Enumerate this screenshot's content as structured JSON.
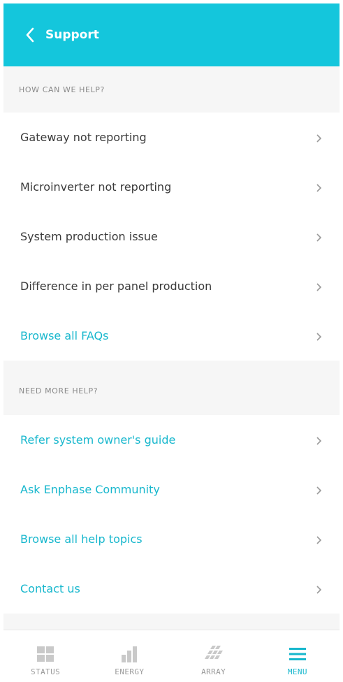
{
  "header": {
    "title": "Support",
    "accent": "#14c6dc"
  },
  "sections": [
    {
      "heading": "HOW CAN WE HELP?",
      "items": [
        {
          "label": "Gateway not reporting",
          "link": false
        },
        {
          "label": "Microinverter not reporting",
          "link": false
        },
        {
          "label": "System production issue",
          "link": false
        },
        {
          "label": "Difference in per panel production",
          "link": false
        },
        {
          "label": "Browse all FAQs",
          "link": true
        }
      ]
    },
    {
      "heading": "NEED MORE HELP?",
      "items": [
        {
          "label": "Refer system owner's guide",
          "link": true
        },
        {
          "label": "Ask Enphase Community",
          "link": true
        },
        {
          "label": "Browse all help topics",
          "link": true
        },
        {
          "label": "Contact us",
          "link": true
        }
      ]
    }
  ],
  "tabbar": {
    "tabs": [
      {
        "label": "STATUS",
        "icon": "status-grid-icon",
        "active": false
      },
      {
        "label": "ENERGY",
        "icon": "energy-bars-icon",
        "active": false
      },
      {
        "label": "ARRAY",
        "icon": "array-panels-icon",
        "active": false
      },
      {
        "label": "MENU",
        "icon": "menu-hamburger-icon",
        "active": true
      }
    ]
  }
}
